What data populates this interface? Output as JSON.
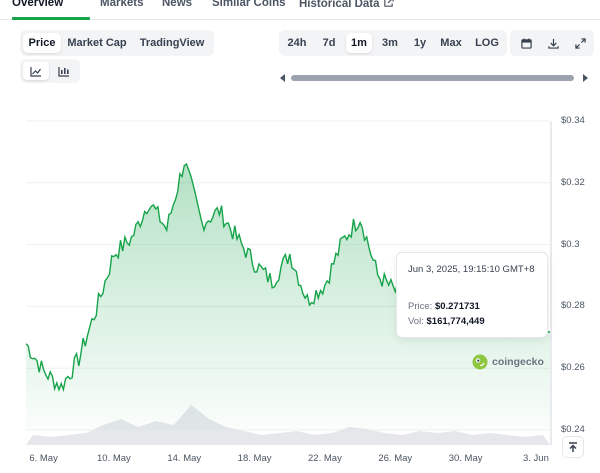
{
  "tabs": [
    {
      "label": "Overview",
      "active": true
    },
    {
      "label": "Markets"
    },
    {
      "label": "News"
    },
    {
      "label": "Similar Coins"
    },
    {
      "label": "Historical Data",
      "icon": "external-link-icon"
    }
  ],
  "chart_type_buttons": [
    {
      "label": "Price",
      "active": true
    },
    {
      "label": "Market Cap"
    },
    {
      "label": "TradingView"
    }
  ],
  "view_toggle": [
    {
      "icon": "line-chart-icon",
      "active": true
    },
    {
      "icon": "candlestick-icon"
    }
  ],
  "range_buttons": [
    {
      "label": "24h"
    },
    {
      "label": "7d"
    },
    {
      "label": "1m",
      "active": true
    },
    {
      "label": "3m"
    },
    {
      "label": "1y"
    },
    {
      "label": "Max"
    },
    {
      "label": "LOG"
    }
  ],
  "toolbar_icons": [
    "calendar-icon",
    "download-icon",
    "expand-icon"
  ],
  "tooltip": {
    "date": "Jun 3, 2025, 19:15:10 GMT+8",
    "price_label": "Price:",
    "price_value": "$0.271731",
    "vol_label": "Vol:",
    "vol_value": "$161,774,449"
  },
  "watermark": {
    "text": "coingecko"
  },
  "colors": {
    "accent": "#16a34a",
    "line": "#16a34a",
    "area_top": "#bbf7d0",
    "volume": "#e5e7eb"
  },
  "chart_data": {
    "type": "area",
    "title": "",
    "xlabel": "",
    "ylabel": "",
    "x_ticks": [
      "6. May",
      "10. May",
      "14. May",
      "18. May",
      "22. May",
      "26. May",
      "30. May",
      "3. Jun"
    ],
    "y_ticks": [
      "$0.34",
      "$0.32",
      "$0.3",
      "$0.28",
      "$0.26",
      "$0.24"
    ],
    "ylim": [
      0.24,
      0.34
    ],
    "grid": true,
    "series": [
      {
        "x": [
          "2025-05-05",
          "2025-05-06",
          "2025-05-07",
          "2025-05-08",
          "2025-05-09",
          "2025-05-10",
          "2025-05-11",
          "2025-05-12",
          "2025-05-13",
          "2025-05-14",
          "2025-05-15",
          "2025-05-16",
          "2025-05-17",
          "2025-05-18",
          "2025-05-19",
          "2025-05-20",
          "2025-05-21",
          "2025-05-22",
          "2025-05-23",
          "2025-05-24",
          "2025-05-25",
          "2025-05-26",
          "2025-05-27",
          "2025-05-28",
          "2025-05-29",
          "2025-05-30",
          "2025-05-31",
          "2025-06-01",
          "2025-06-02",
          "2025-06-03"
        ],
        "values": [
          0.268,
          0.259,
          0.254,
          0.263,
          0.279,
          0.297,
          0.302,
          0.314,
          0.305,
          0.327,
          0.307,
          0.311,
          0.302,
          0.294,
          0.288,
          0.297,
          0.282,
          0.287,
          0.301,
          0.309,
          0.29,
          0.285,
          0.281,
          0.284,
          0.289,
          0.286,
          0.288,
          0.283,
          0.279,
          0.272
        ]
      }
    ],
    "volume": [
      0.05,
      0.04,
      0.05,
      0.06,
      0.1,
      0.13,
      0.09,
      0.12,
      0.1,
      0.2,
      0.13,
      0.09,
      0.07,
      0.05,
      0.06,
      0.07,
      0.05,
      0.06,
      0.09,
      0.08,
      0.06,
      0.05,
      0.07,
      0.06,
      0.07,
      0.05,
      0.06,
      0.05,
      0.04,
      0.05
    ],
    "tooltip_point": {
      "x": "2025-06-03",
      "y": 0.271731
    }
  }
}
